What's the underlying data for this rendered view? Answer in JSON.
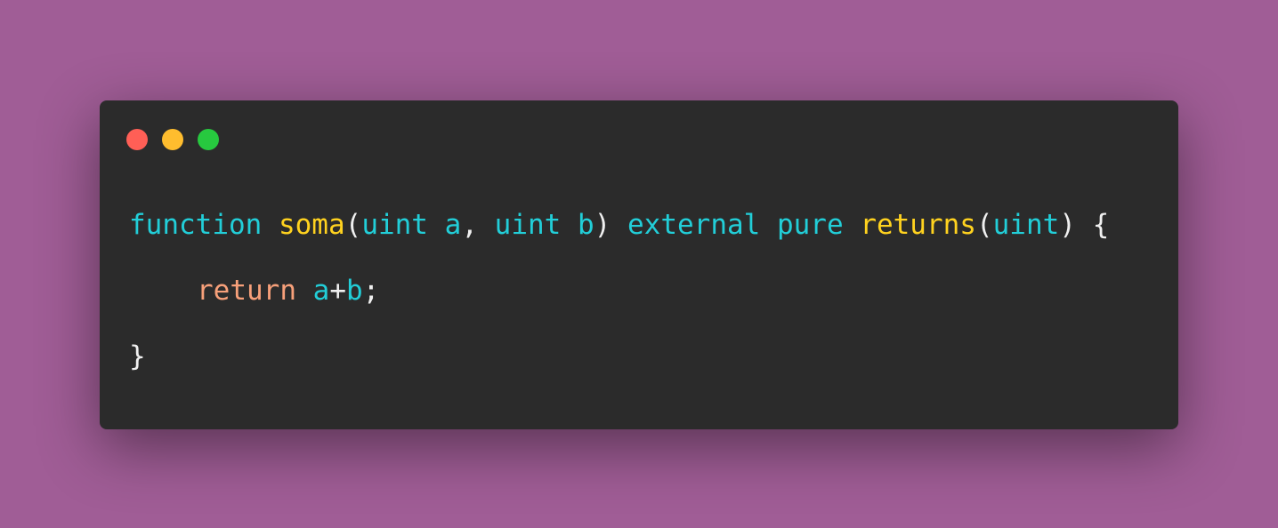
{
  "colors": {
    "background": "#a05d96",
    "window": "#2b2b2b",
    "close": "#ff5f56",
    "minimize": "#ffbd2e",
    "maximize": "#27c93f",
    "keyword": "#22ced8",
    "name": "#ffd21f",
    "return": "#f7a07a",
    "punct": "#f0f0f0"
  },
  "window_controls": [
    "close",
    "minimize",
    "maximize"
  ],
  "code": {
    "lines": [
      {
        "indent": false,
        "tokens": [
          {
            "text": "function",
            "type": "keyword"
          },
          {
            "text": " ",
            "type": "space"
          },
          {
            "text": "soma",
            "type": "name"
          },
          {
            "text": "(",
            "type": "punct"
          },
          {
            "text": "uint",
            "type": "keyword"
          },
          {
            "text": " ",
            "type": "space"
          },
          {
            "text": "a",
            "type": "keyword"
          },
          {
            "text": ",",
            "type": "punct"
          },
          {
            "text": " ",
            "type": "space"
          },
          {
            "text": "uint",
            "type": "keyword"
          },
          {
            "text": " ",
            "type": "space"
          },
          {
            "text": "b",
            "type": "keyword"
          },
          {
            "text": ")",
            "type": "punct"
          },
          {
            "text": " ",
            "type": "space"
          },
          {
            "text": "external",
            "type": "keyword"
          },
          {
            "text": " ",
            "type": "space"
          },
          {
            "text": "pure",
            "type": "keyword"
          },
          {
            "text": " ",
            "type": "space"
          },
          {
            "text": "returns",
            "type": "name"
          },
          {
            "text": "(",
            "type": "punct"
          },
          {
            "text": "uint",
            "type": "keyword"
          },
          {
            "text": ")",
            "type": "punct"
          },
          {
            "text": " ",
            "type": "space"
          },
          {
            "text": "{",
            "type": "punct"
          }
        ]
      },
      {
        "indent": true,
        "tokens": [
          {
            "text": "return",
            "type": "return"
          },
          {
            "text": " ",
            "type": "space"
          },
          {
            "text": "a",
            "type": "keyword"
          },
          {
            "text": "+",
            "type": "punct"
          },
          {
            "text": "b",
            "type": "keyword"
          },
          {
            "text": ";",
            "type": "punct"
          }
        ]
      },
      {
        "indent": false,
        "tokens": [
          {
            "text": "}",
            "type": "punct"
          }
        ]
      }
    ]
  }
}
